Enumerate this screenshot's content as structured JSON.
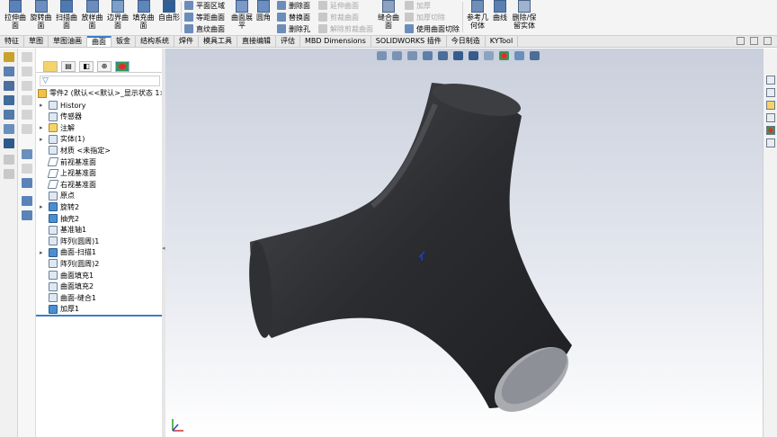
{
  "ribbon": {
    "big_buttons": [
      {
        "label": "拉伸曲\n面",
        "icon": "extrude-surface-icon"
      },
      {
        "label": "旋转曲\n面",
        "icon": "revolve-surface-icon"
      },
      {
        "label": "扫描曲\n面",
        "icon": "sweep-surface-icon"
      },
      {
        "label": "放样曲\n面",
        "icon": "loft-surface-icon"
      },
      {
        "label": "边界曲\n面",
        "icon": "boundary-surface-icon"
      },
      {
        "label": "填充曲\n面",
        "icon": "fill-surface-icon"
      },
      {
        "label": "自由形",
        "icon": "freeform-icon"
      }
    ],
    "col1": [
      {
        "label": "平面区域",
        "disabled": false
      },
      {
        "label": "等距曲面",
        "disabled": false
      },
      {
        "label": "直纹曲面",
        "disabled": false
      }
    ],
    "flatten_label": "曲面展\n平",
    "fillet_label": "圆角",
    "col2": [
      {
        "label": "删除面",
        "disabled": false
      },
      {
        "label": "替换面",
        "disabled": false
      },
      {
        "label": "删除孔",
        "disabled": false
      }
    ],
    "col3": [
      {
        "label": "延伸曲面",
        "disabled": true
      },
      {
        "label": "剪裁曲面",
        "disabled": true
      },
      {
        "label": "解除剪裁曲面",
        "disabled": true
      }
    ],
    "knit_label": "缝合曲\n面",
    "col4": [
      {
        "label": "加厚",
        "disabled": true
      },
      {
        "label": "加厚切除",
        "disabled": true
      },
      {
        "label": "使用曲面切除",
        "disabled": false
      }
    ],
    "ref_geometry_label": "参考几\n何体",
    "curves_label": "曲线",
    "delete_keep_body_label": "删除/保\n留实体"
  },
  "tabs": [
    "特征",
    "草图",
    "草图油画",
    "曲面",
    "钣金",
    "结构系统",
    "焊件",
    "模具工具",
    "直接编辑",
    "评估",
    "MBD Dimensions",
    "SOLIDWORKS 插件",
    "今日制造",
    "KYTool"
  ],
  "active_tab": "曲面",
  "tree": {
    "root_label": "零件2 (默认<<默认>_显示状态 1>)",
    "items": [
      {
        "label": "History",
        "arrow": "▸",
        "icon": "history-icon",
        "style": ""
      },
      {
        "label": "传感器",
        "arrow": "",
        "icon": "sensor-icon",
        "style": ""
      },
      {
        "label": "注解",
        "arrow": "▸",
        "icon": "annotation-icon",
        "style": "yellow"
      },
      {
        "label": "实体(1)",
        "arrow": "▸",
        "icon": "solid-bodies-icon",
        "style": ""
      },
      {
        "label": "材质 <未指定>",
        "arrow": "",
        "icon": "material-icon",
        "style": ""
      },
      {
        "label": "前视基准面",
        "arrow": "",
        "icon": "plane-icon",
        "style": "plane"
      },
      {
        "label": "上视基准面",
        "arrow": "",
        "icon": "plane-icon",
        "style": "plane"
      },
      {
        "label": "右视基准面",
        "arrow": "",
        "icon": "plane-icon",
        "style": "plane"
      },
      {
        "label": "原点",
        "arrow": "",
        "icon": "origin-icon",
        "style": ""
      },
      {
        "label": "旋转2",
        "arrow": "▸",
        "icon": "revolve-feature-icon",
        "style": "blue"
      },
      {
        "label": "抽壳2",
        "arrow": "",
        "icon": "shell-feature-icon",
        "style": "blue"
      },
      {
        "label": "基准轴1",
        "arrow": "",
        "icon": "axis-icon",
        "style": ""
      },
      {
        "label": "阵列(圆周)1",
        "arrow": "",
        "icon": "circular-pattern-icon",
        "style": ""
      },
      {
        "label": "曲面-扫描1",
        "arrow": "▸",
        "icon": "sweep-surface-feature-icon",
        "style": "blue"
      },
      {
        "label": "阵列(圆周)2",
        "arrow": "",
        "icon": "circular-pattern-icon",
        "style": ""
      },
      {
        "label": "曲面填充1",
        "arrow": "",
        "icon": "fill-surface-feature-icon",
        "style": ""
      },
      {
        "label": "曲面填充2",
        "arrow": "",
        "icon": "fill-surface-feature-icon",
        "style": ""
      },
      {
        "label": "曲面-缝合1",
        "arrow": "",
        "icon": "knit-surface-feature-icon",
        "style": ""
      },
      {
        "label": "加厚1",
        "arrow": "",
        "icon": "thicken-feature-icon",
        "style": "blue"
      }
    ]
  },
  "colors": {
    "accent": "#3b7dc9",
    "model": "#2b2c2f"
  }
}
